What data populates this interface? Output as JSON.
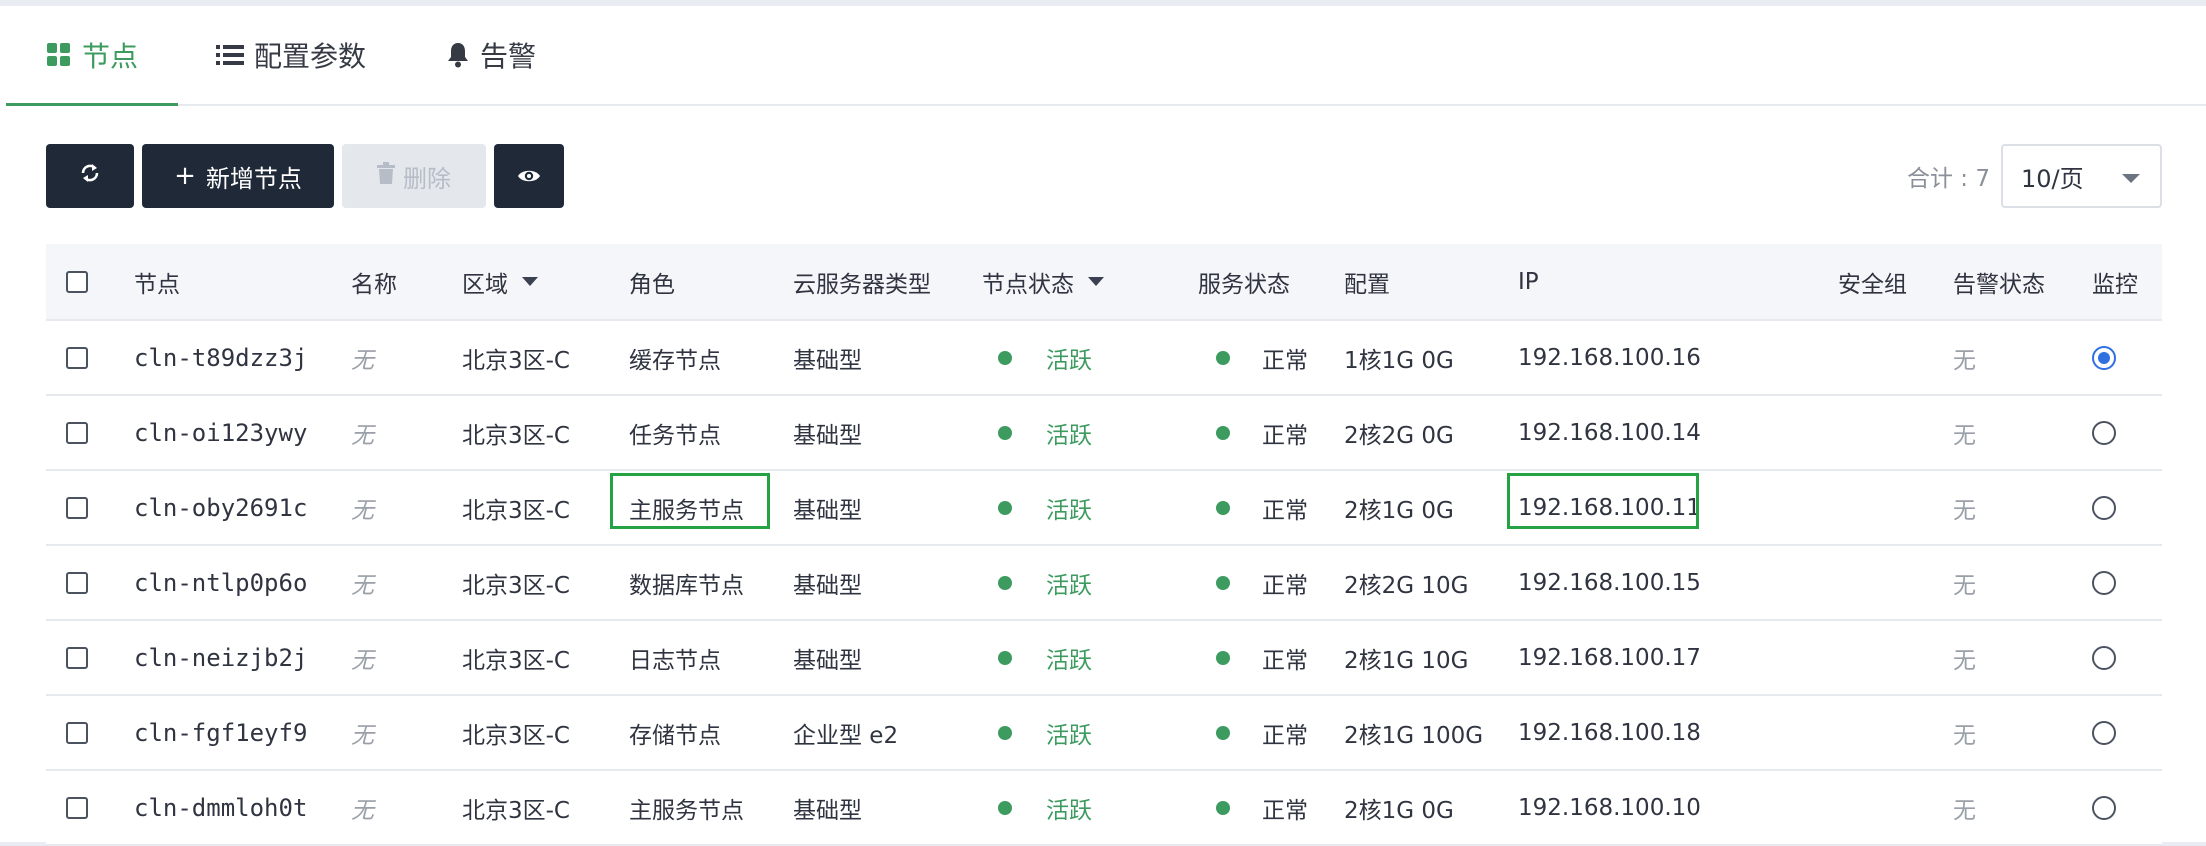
{
  "tabs": [
    {
      "label": "节点",
      "icon": "grid-icon",
      "active": true
    },
    {
      "label": "配置参数",
      "icon": "list-icon",
      "active": false
    },
    {
      "label": "告警",
      "icon": "bell-icon",
      "active": false
    }
  ],
  "toolbar": {
    "refresh_icon": "refresh-icon",
    "add_label": "新增节点",
    "delete_label": "删除",
    "view_icon": "eye-icon"
  },
  "pagination": {
    "total_label": "合计 : 7",
    "page_size": "10/页"
  },
  "table": {
    "columns": [
      "节点",
      "名称",
      "区域",
      "角色",
      "云服务器类型",
      "节点状态",
      "服务状态",
      "配置",
      "IP",
      "安全组",
      "告警状态",
      "监控"
    ],
    "rows": [
      {
        "node": "cln-t89dzz3j",
        "name": "无",
        "zone": "北京3区-C",
        "role": "缓存节点",
        "type": "基础型",
        "node_status": "活跃",
        "service_status": "正常",
        "config": "1核1G 0G",
        "ip": "192.168.100.16",
        "security_group": "",
        "alert_status": "无",
        "monitor": true
      },
      {
        "node": "cln-oi123ywy",
        "name": "无",
        "zone": "北京3区-C",
        "role": "任务节点",
        "type": "基础型",
        "node_status": "活跃",
        "service_status": "正常",
        "config": "2核2G 0G",
        "ip": "192.168.100.14",
        "security_group": "",
        "alert_status": "无",
        "monitor": false
      },
      {
        "node": "cln-oby2691c",
        "name": "无",
        "zone": "北京3区-C",
        "role": "主服务节点",
        "type": "基础型",
        "node_status": "活跃",
        "service_status": "正常",
        "config": "2核1G 0G",
        "ip": "192.168.100.11",
        "security_group": "",
        "alert_status": "无",
        "monitor": false
      },
      {
        "node": "cln-ntlp0p6o",
        "name": "无",
        "zone": "北京3区-C",
        "role": "数据库节点",
        "type": "基础型",
        "node_status": "活跃",
        "service_status": "正常",
        "config": "2核2G 10G",
        "ip": "192.168.100.15",
        "security_group": "",
        "alert_status": "无",
        "monitor": false
      },
      {
        "node": "cln-neizjb2j",
        "name": "无",
        "zone": "北京3区-C",
        "role": "日志节点",
        "type": "基础型",
        "node_status": "活跃",
        "service_status": "正常",
        "config": "2核1G 10G",
        "ip": "192.168.100.17",
        "security_group": "",
        "alert_status": "无",
        "monitor": false
      },
      {
        "node": "cln-fgf1eyf9",
        "name": "无",
        "zone": "北京3区-C",
        "role": "存储节点",
        "type": "企业型 e2",
        "node_status": "活跃",
        "service_status": "正常",
        "config": "2核1G 100G",
        "ip": "192.168.100.18",
        "security_group": "",
        "alert_status": "无",
        "monitor": false
      },
      {
        "node": "cln-dmmloh0t",
        "name": "无",
        "zone": "北京3区-C",
        "role": "主服务节点",
        "type": "基础型",
        "node_status": "活跃",
        "service_status": "正常",
        "config": "2核1G 0G",
        "ip": "192.168.100.10",
        "security_group": "",
        "alert_status": "无",
        "monitor": false
      }
    ]
  },
  "colors": {
    "accent": "#3d9b5f",
    "dark_button": "#1f2937",
    "highlight": "#25a243",
    "radio_selected": "#2f6fe0"
  }
}
